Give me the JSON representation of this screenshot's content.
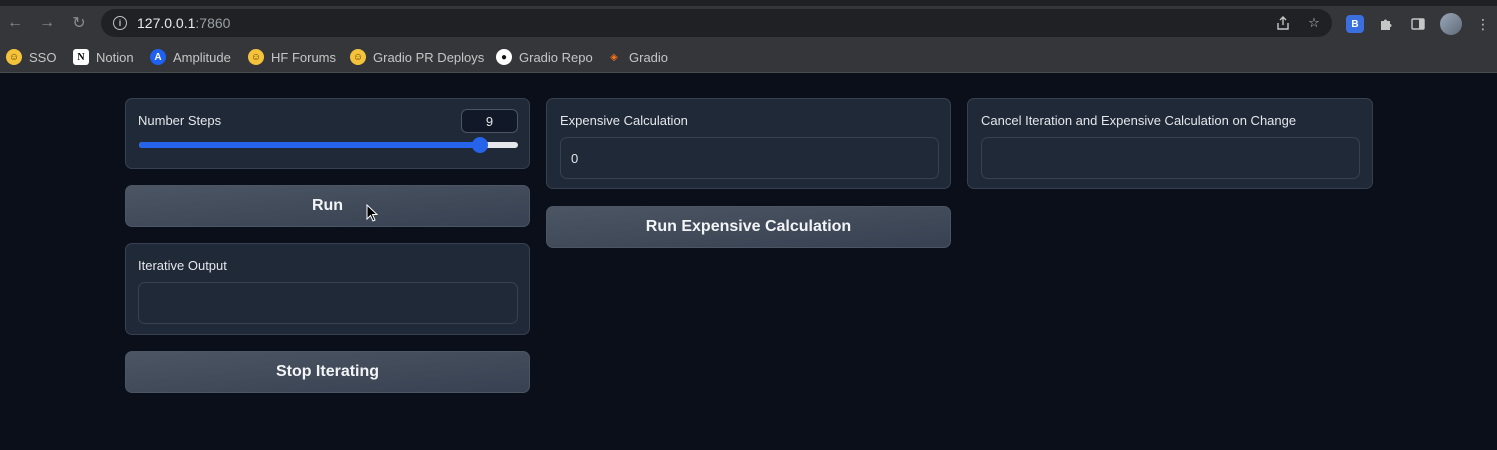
{
  "browser": {
    "url_host": "127.0.0.1",
    "url_port": ":7860",
    "nav": {
      "back_icon": "←",
      "forward_icon": "→",
      "reload_icon": "↻"
    },
    "bookmarks": [
      {
        "label": "SSO",
        "icon": "hugging-face-icon"
      },
      {
        "label": "Notion",
        "icon": "notion-icon"
      },
      {
        "label": "Amplitude",
        "icon": "amplitude-icon"
      },
      {
        "label": "HF Forums",
        "icon": "hugging-face-icon"
      },
      {
        "label": "Gradio PR Deploys",
        "icon": "hugging-face-icon"
      },
      {
        "label": "Gradio Repo",
        "icon": "github-icon"
      },
      {
        "label": "Gradio",
        "icon": "gradio-icon"
      }
    ]
  },
  "app": {
    "slider": {
      "label": "Number Steps",
      "value": "9",
      "fraction": 0.9
    },
    "run_button": "Run",
    "iterative_output": {
      "label": "Iterative Output",
      "value": ""
    },
    "stop_button": "Stop Iterating",
    "expensive": {
      "label": "Expensive Calculation",
      "value": "0"
    },
    "run_expensive_button": "Run Expensive Calculation",
    "cancel_on_change": {
      "label": "Cancel Iteration and Expensive Calculation on Change",
      "value": ""
    }
  },
  "colors": {
    "accent": "#2563eb",
    "background": "#0b0f19",
    "panel": "#1f2937"
  }
}
